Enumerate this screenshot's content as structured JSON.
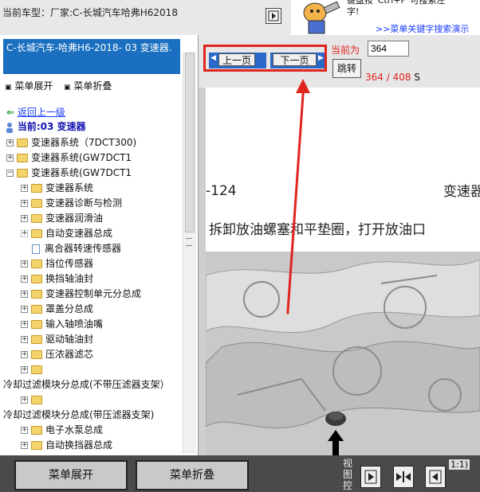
{
  "topbar": {
    "car_label": "当前车型：厂家:C-长城汽车哈弗H62018",
    "hint_line1": "键盘按“Ctrl+F”可搜索左",
    "hint_line2": "字!",
    "hint_link": ">>菜单关键字搜索演示"
  },
  "tree": {
    "title": "C-长城汽车-哈弗H6-2018- 03 变速器.",
    "expand_all": "菜单展开",
    "collapse_all": "菜单折叠",
    "back": "返回上一级",
    "current": "当前:03 变速器",
    "items": [
      {
        "label": "变速器系统（7DCT300)"
      },
      {
        "label": "变速器系统(GW7DCT1"
      },
      {
        "label": "变速器系统(GW7DCT1"
      },
      {
        "label": "变速器系统"
      },
      {
        "label": "变速器诊断与检测"
      },
      {
        "label": "变速器润滑油"
      },
      {
        "label": "自动变速器总成"
      },
      {
        "label": "离合器转速传感器"
      },
      {
        "label": "挡位传感器"
      },
      {
        "label": "换挡轴油封"
      },
      {
        "label": "变速器控制单元分总成"
      },
      {
        "label": "罩盖分总成"
      },
      {
        "label": "输入轴喷油嘴"
      },
      {
        "label": "驱动轴油封"
      },
      {
        "label": "压浓器滤芯"
      },
      {
        "label": ""
      },
      {
        "label": "冷却过滤模块分总成(不带压滤器支架）"
      },
      {
        "label": ""
      },
      {
        "label": "冷却过滤模块分总成(带压滤器支架)"
      },
      {
        "label": "电子水泵总成"
      },
      {
        "label": "自动换挡器总成"
      }
    ]
  },
  "pager": {
    "prev": "上一页",
    "next": "下一页",
    "current_label": "当前为",
    "page_value": "364",
    "jump": "跳转",
    "page_current": "364",
    "page_sep": " / ",
    "page_total": "408",
    "page_suffix": "S"
  },
  "document": {
    "code": "-124",
    "section": "变速器",
    "step": "拆卸放油螺塞和平垫圈，打开放油口"
  },
  "bottom": {
    "expand_btn": "菜单展开",
    "collapse_btn": "菜单折叠",
    "view_ctrl": "视图控",
    "ratio": "1:1)"
  },
  "colors": {
    "title_bg": "#1a6fc0",
    "accent_red": "#e0241e",
    "link_blue": "#1a3cff"
  }
}
